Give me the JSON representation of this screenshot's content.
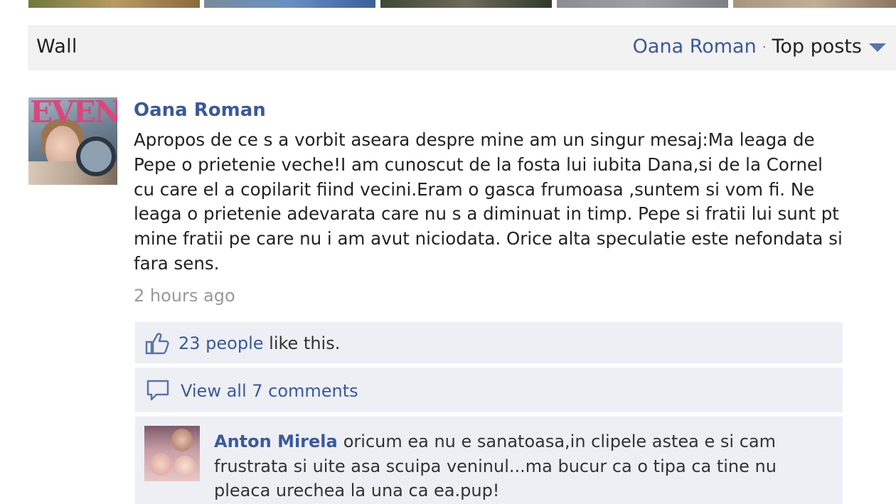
{
  "header": {
    "wall_title": "Wall",
    "filter_name": "Oana Roman",
    "filter_separator": "·",
    "filter_mode": "Top posts"
  },
  "post": {
    "author": "Oana Roman",
    "text": "Apropos de ce s a vorbit aseara despre mine am un singur mesaj:Ma leaga de Pepe o prietenie veche!I am cunoscut de la fosta lui iubita Dana,si de la Cornel cu care el a copilarit fiind vecini.Eram o gasca frumoasa ,suntem si vom fi. Ne leaga o prietenie adevarata care nu s a diminuat in timp. Pepe si fratii lui sunt pt mine fratii pe care nu i am avut niciodata. Orice alta speculatie este nefondata si fara sens.",
    "timestamp": "2 hours ago",
    "avatar_text": "EVENT"
  },
  "likes": {
    "count_text": "23 people",
    "suffix": " like this."
  },
  "comments": {
    "view_all_label": "View all 7 comments",
    "items": [
      {
        "author": "Anton Mirela",
        "text": "oricum ea nu e sanatoasa,in clipele astea e si cam frustrata si uite asa scuipa veninul...ma bucur ca o tipa ca tine nu pleaca urechea la una ca ea.pup!"
      }
    ]
  },
  "colors": {
    "link": "#3b5998",
    "panel_bg": "#edeff4",
    "header_bg": "#f2f2f2",
    "timestamp": "#999999"
  },
  "icons": {
    "dropdown": "caret-down-icon",
    "like": "thumbs-up-icon",
    "comment": "speech-bubble-icon"
  }
}
